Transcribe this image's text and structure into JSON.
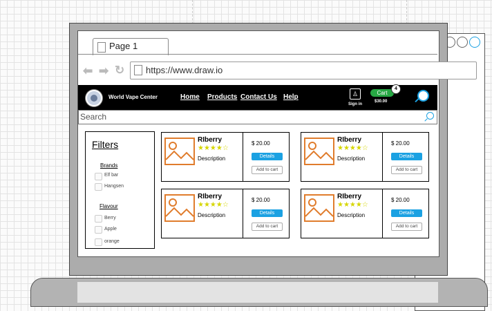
{
  "browser": {
    "tab_label": "Page 1",
    "url": "https://www.draw.io"
  },
  "navbar": {
    "brand": "World Vape Center",
    "links": [
      "Home",
      "Products",
      "Contact Us",
      "Help"
    ],
    "signin_label": "Sign in",
    "cart_label": "Cart",
    "cart_count": "4",
    "cart_total": "$30.00"
  },
  "search": {
    "placeholder": "Search"
  },
  "filters": {
    "title": "Filters",
    "brands_title": "Brands",
    "brands": [
      "Elf bar",
      "Hangsen"
    ],
    "flavour_title": "Flavour",
    "flavours": [
      "Berry",
      "Apple",
      "orange"
    ]
  },
  "products": [
    {
      "name": "RIberry",
      "rating_stars": "★★★★☆",
      "rating": 4,
      "description": "Description",
      "price": "$ 20.00",
      "details_label": "Details",
      "add_label": "Add to cart"
    },
    {
      "name": "RIberry",
      "rating_stars": "★★★★☆",
      "rating": 4,
      "description": "Description",
      "price": "$ 20.00",
      "details_label": "Details",
      "add_label": "Add to cart"
    },
    {
      "name": "RIberry",
      "rating_stars": "★★★★☆",
      "rating": 4,
      "description": "Description",
      "price": "$ 20.00",
      "details_label": "Details",
      "add_label": "Add to cart"
    },
    {
      "name": "RIberry",
      "rating_stars": "★★★★☆",
      "rating": 4,
      "description": "Description",
      "price": "$ 20.00",
      "details_label": "Details",
      "add_label": "Add to cart"
    }
  ],
  "colors": {
    "navbar": "#000000",
    "accent_blue": "#1ba1e2",
    "cart_green": "#27a844",
    "image_orange": "#e07c2c",
    "star_yellow": "#d6d600"
  }
}
